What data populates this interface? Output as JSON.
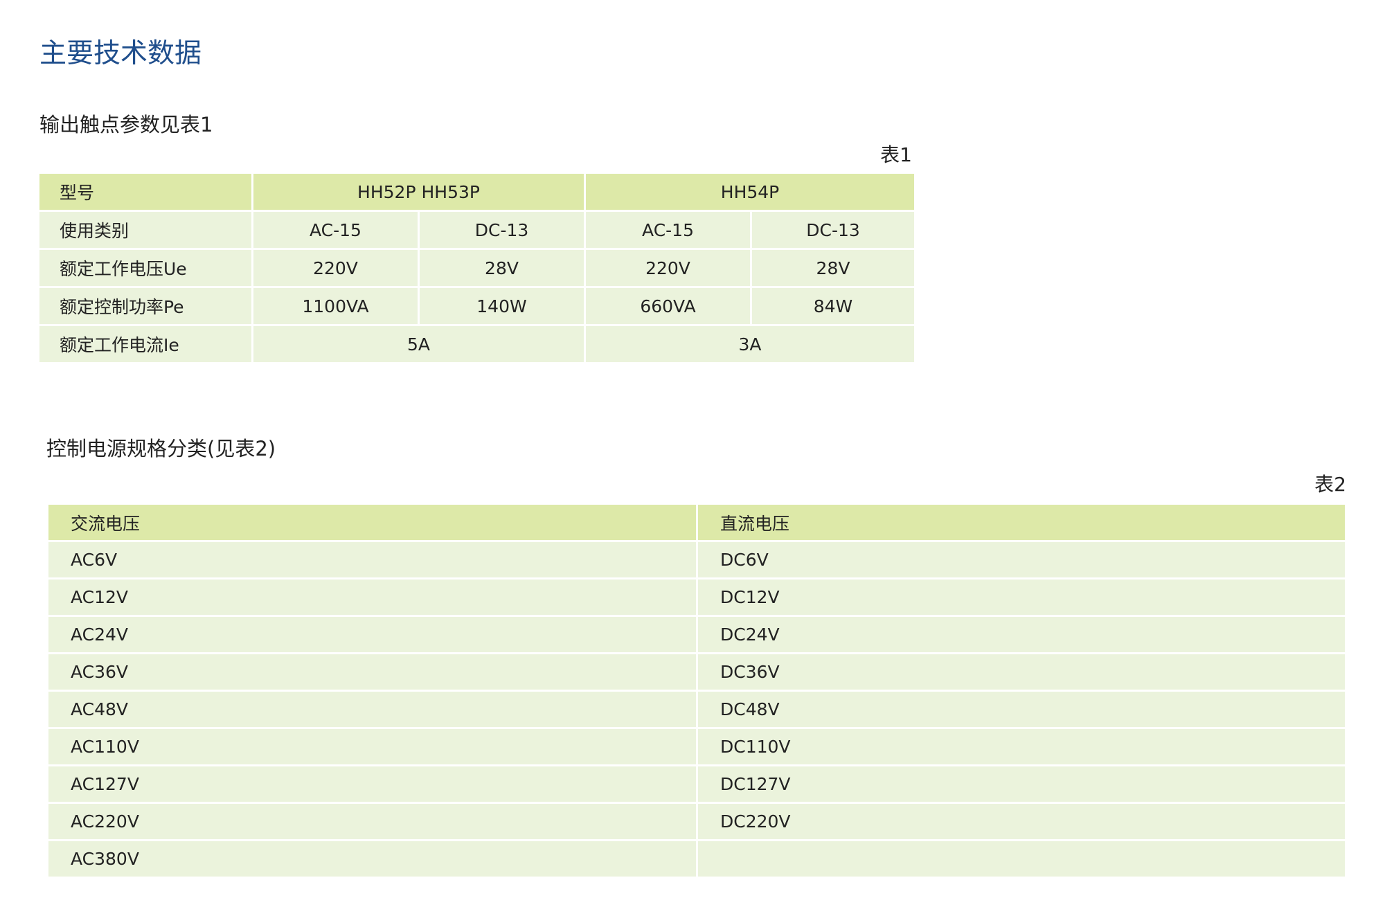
{
  "page_title": "主要技术数据",
  "section1": {
    "heading": "输出触点参数见表1",
    "caption": "表1",
    "header": {
      "label": "型号",
      "group1": "HH52P  HH53P",
      "group2": "HH54P"
    },
    "rows": [
      {
        "label": "使用类别",
        "cells": [
          "AC-15",
          "DC-13",
          "AC-15",
          "DC-13"
        ]
      },
      {
        "label": "额定工作电压Ue",
        "cells": [
          "220V",
          "28V",
          "220V",
          "28V"
        ]
      },
      {
        "label": "额定控制功率Pe",
        "cells": [
          "1100VA",
          "140W",
          "660VA",
          "84W"
        ]
      }
    ],
    "current_row": {
      "label": "额定工作电流Ie",
      "group1": "5A",
      "group2": "3A"
    }
  },
  "section2": {
    "heading": "控制电源规格分类(见表2)",
    "caption": "表2",
    "columns": [
      "交流电压",
      "直流电压"
    ],
    "rows": [
      [
        "AC6V",
        "DC6V"
      ],
      [
        "AC12V",
        "DC12V"
      ],
      [
        "AC24V",
        "DC24V"
      ],
      [
        "AC36V",
        "DC36V"
      ],
      [
        "AC48V",
        "DC48V"
      ],
      [
        "AC110V",
        "DC110V"
      ],
      [
        "AC127V",
        "DC127V"
      ],
      [
        "AC220V",
        "DC220V"
      ],
      [
        "AC380V",
        ""
      ]
    ]
  }
}
